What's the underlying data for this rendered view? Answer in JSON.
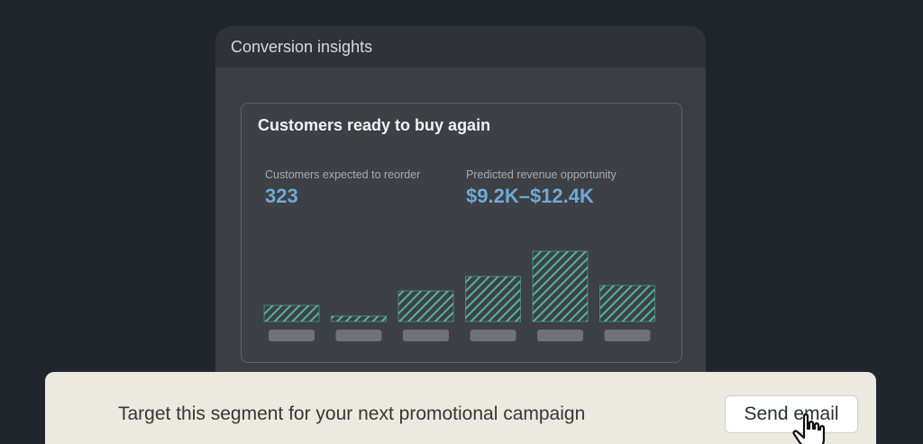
{
  "window": {
    "title": "Conversion insights"
  },
  "card": {
    "title": "Customers ready to buy again",
    "metrics": [
      {
        "label": "Customers expected to reorder",
        "value": "323"
      },
      {
        "label": "Predicted revenue opportunity",
        "value": "$9.2K–$12.4K"
      }
    ]
  },
  "chart_data": {
    "type": "bar",
    "categories": [
      "",
      "",
      "",
      "",
      "",
      ""
    ],
    "values": [
      18,
      6,
      34,
      50,
      78,
      40
    ],
    "ylim": [
      0,
      80
    ],
    "grid": false,
    "colors": {
      "bar": "#4fb59f",
      "label_placeholder": "#6f7276"
    }
  },
  "banner": {
    "text": "Target this segment for your next promotional campaign",
    "button_label": "Send email"
  },
  "icons": {
    "cursor": "hand-pointer-icon"
  }
}
